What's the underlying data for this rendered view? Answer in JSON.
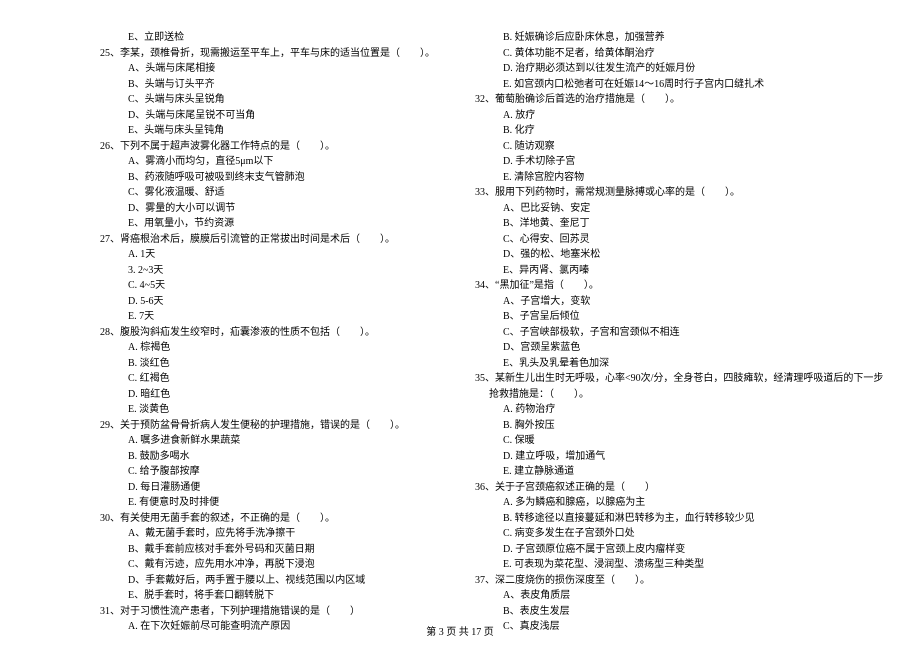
{
  "left": [
    {
      "cls": "opt-line",
      "text": "E、立即送检"
    },
    {
      "cls": "q-line",
      "text": "25、李某，颈椎骨折，现需搬运至平车上，平车与床的适当位置是（　　）。"
    },
    {
      "cls": "opt-line",
      "text": "A、头端与床尾相接"
    },
    {
      "cls": "opt-line",
      "text": "B、头端与订头平齐"
    },
    {
      "cls": "opt-line",
      "text": "C、头端与床头呈锐角"
    },
    {
      "cls": "opt-line",
      "text": "D、头端与床尾呈锐不可当角"
    },
    {
      "cls": "opt-line",
      "text": "E、头端与床头呈钝角"
    },
    {
      "cls": "q-line",
      "text": "26、下列不属于超声波雾化器工作特点的是（　　）。"
    },
    {
      "cls": "opt-line",
      "text": "A、雾滴小而均匀，直径5μm以下"
    },
    {
      "cls": "opt-line",
      "text": "B、药液随呼吸可被吸到终末支气管肺泡"
    },
    {
      "cls": "opt-line",
      "text": "C、雾化液温暖、舒适"
    },
    {
      "cls": "opt-line",
      "text": "D、雾量的大小可以调节"
    },
    {
      "cls": "opt-line",
      "text": "E、用氧量小，节约资源"
    },
    {
      "cls": "q-line",
      "text": "27、肾癌根治术后，膜膜后引流管的正常拔出时间是术后（　　）。"
    },
    {
      "cls": "opt-line",
      "text": "A. 1天"
    },
    {
      "cls": "opt-line",
      "text": "3. 2~3天"
    },
    {
      "cls": "opt-line",
      "text": "C. 4~5天"
    },
    {
      "cls": "opt-line",
      "text": "D. 5-6天"
    },
    {
      "cls": "opt-line",
      "text": "E. 7天"
    },
    {
      "cls": "q-line",
      "text": "28、腹股沟斜疝发生绞窄时，疝囊渗液的性质不包括（　　）。"
    },
    {
      "cls": "opt-line",
      "text": "A. 棕褐色"
    },
    {
      "cls": "opt-line",
      "text": "B. 淡红色"
    },
    {
      "cls": "opt-line",
      "text": "C. 红褐色"
    },
    {
      "cls": "opt-line",
      "text": "D. 暗红色"
    },
    {
      "cls": "opt-line",
      "text": "E. 淡黄色"
    },
    {
      "cls": "q-line",
      "text": "29、关于预防盆骨骨折病人发生便秘的护理措施，错误的是（　　）。"
    },
    {
      "cls": "opt-line",
      "text": "A. 嘱多进食新鲜水果蔬菜"
    },
    {
      "cls": "opt-line",
      "text": "B. 鼓励多喝水"
    },
    {
      "cls": "opt-line",
      "text": "C. 给予腹部按摩"
    },
    {
      "cls": "opt-line",
      "text": "D. 每日灌肠通便"
    },
    {
      "cls": "opt-line",
      "text": "E. 有便意时及时排便"
    },
    {
      "cls": "q-line",
      "text": "30、有关使用无菌手套的叙述，不正确的是（　　）。"
    },
    {
      "cls": "opt-line",
      "text": "A、戴无菌手套时，应先将手洗净擦干"
    },
    {
      "cls": "opt-line",
      "text": "B、戴手套前应核对手套外号码和灭菌日期"
    },
    {
      "cls": "opt-line",
      "text": "C、戴有污迹，应先用水冲净，再脱下浸泡"
    },
    {
      "cls": "opt-line",
      "text": "D、手套戴好后，两手置于腰以上、视线范围以内区域"
    },
    {
      "cls": "opt-line",
      "text": "E、脱手套时，将手套口翻转脱下"
    },
    {
      "cls": "q-line",
      "text": "31、对于习惯性流产患者，下列护理措施错误的是（　　）"
    },
    {
      "cls": "opt-line",
      "text": "A. 在下次妊娠前尽可能查明流产原因"
    }
  ],
  "right": [
    {
      "cls": "opt-line",
      "text": "B. 妊娠确诊后应卧床休息，加强营养"
    },
    {
      "cls": "opt-line",
      "text": "C. 黄体功能不足者，给黄体酮治疗"
    },
    {
      "cls": "opt-line",
      "text": "D. 治疗期必须达到以往发生流产的妊娠月份"
    },
    {
      "cls": "opt-line",
      "text": "E. 如宫颈内口松弛者可在妊娠14～16周时行子宫内口缝扎术"
    },
    {
      "cls": "q-line",
      "text": "32、葡萄胎确诊后首选的治疗措施是（　　）。"
    },
    {
      "cls": "opt-line",
      "text": "A. 放疗"
    },
    {
      "cls": "opt-line",
      "text": "B. 化疗"
    },
    {
      "cls": "opt-line",
      "text": "C. 随访观察"
    },
    {
      "cls": "opt-line",
      "text": "D. 手术切除子宫"
    },
    {
      "cls": "opt-line",
      "text": "E. 清除宫腔内容物"
    },
    {
      "cls": "q-line",
      "text": "33、服用下列药物时，需常规测量脉搏或心率的是（　　）。"
    },
    {
      "cls": "opt-line",
      "text": "A、巴比妥钠、安定"
    },
    {
      "cls": "opt-line",
      "text": "B、洋地黄、奎尼丁"
    },
    {
      "cls": "opt-line",
      "text": "C、心得安、回苏灵"
    },
    {
      "cls": "opt-line",
      "text": "D、强的松、地塞米松"
    },
    {
      "cls": "opt-line",
      "text": "E、异丙肾、氯丙嗪"
    },
    {
      "cls": "q-line",
      "text": "34、“黑加征”是指（　　）。"
    },
    {
      "cls": "opt-line",
      "text": "A、子宫增大，变软"
    },
    {
      "cls": "opt-line",
      "text": "B、子宫呈后倾位"
    },
    {
      "cls": "opt-line",
      "text": "C、子宫峡部极软，子宫和宫颈似不相连"
    },
    {
      "cls": "opt-line",
      "text": "D、宫颈呈紫蓝色"
    },
    {
      "cls": "opt-line",
      "text": "E、乳头及乳晕着色加深"
    },
    {
      "cls": "q-line",
      "text": "35、某新生儿出生时无呼吸，心率<90次/分，全身苍白，四肢瘫软，经清理呼吸道后的下一步"
    },
    {
      "cls": "opt-line-deep",
      "text": "抢救措施是：（　　）。"
    },
    {
      "cls": "opt-line",
      "text": "A. 药物治疗"
    },
    {
      "cls": "opt-line",
      "text": "B. 胸外按压"
    },
    {
      "cls": "opt-line",
      "text": "C. 保暖"
    },
    {
      "cls": "opt-line",
      "text": "D. 建立呼吸，增加通气"
    },
    {
      "cls": "opt-line",
      "text": "E. 建立静脉通道"
    },
    {
      "cls": "q-line",
      "text": "36、关于子宫颈癌叙述正确的是（　　）"
    },
    {
      "cls": "opt-line",
      "text": "A. 多为鳞癌和腺癌，以腺癌为主"
    },
    {
      "cls": "opt-line",
      "text": "B. 转移途径以直接蔓延和淋巴转移为主，血行转移较少见"
    },
    {
      "cls": "opt-line",
      "text": "C. 病变多发生在子宫颈外口处"
    },
    {
      "cls": "opt-line",
      "text": "D. 子宫颈原位癌不属于宫颈上皮内瘤样变"
    },
    {
      "cls": "opt-line",
      "text": "E. 可表现为菜花型、浸润型、溃疡型三种类型"
    },
    {
      "cls": "q-line",
      "text": "37、深二度烧伤的损伤深度至（　　）。"
    },
    {
      "cls": "opt-line",
      "text": "A、表皮角质层"
    },
    {
      "cls": "opt-line",
      "text": "B、表皮生发层"
    },
    {
      "cls": "opt-line",
      "text": "C、真皮浅层"
    }
  ],
  "footer": "第 3 页 共 17 页"
}
